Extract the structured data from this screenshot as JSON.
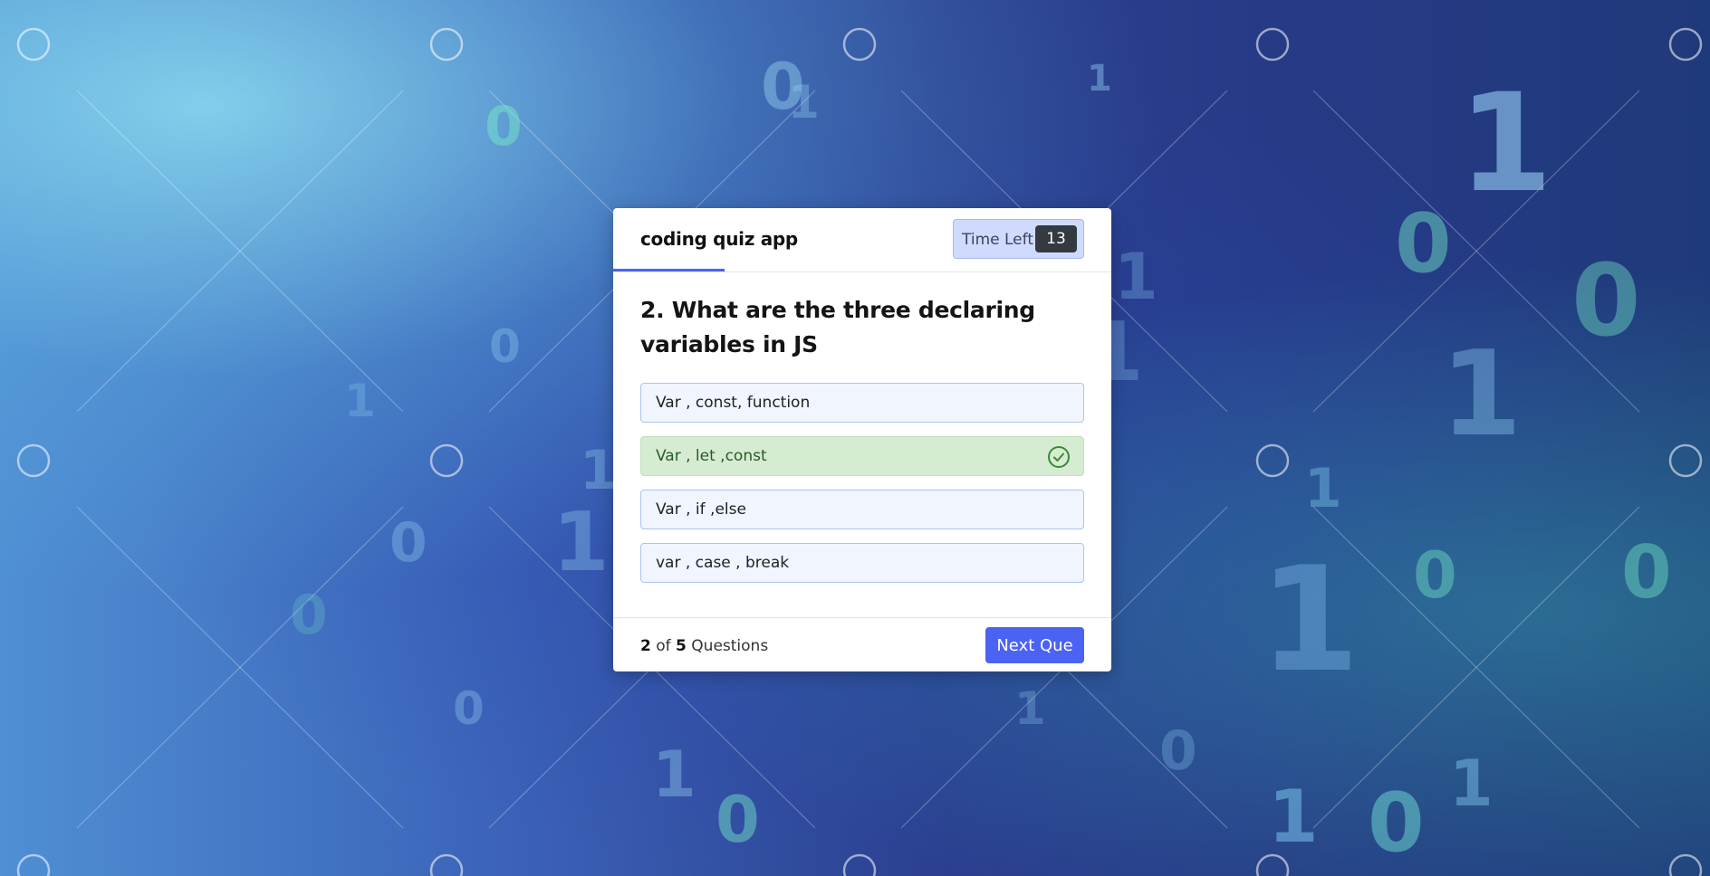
{
  "app": {
    "title": "coding quiz app"
  },
  "timer": {
    "label": "Time Left",
    "value": "13"
  },
  "question": {
    "number": "2",
    "text": "2. What are the three declaring variables in JS"
  },
  "options": [
    {
      "label": "Var , const, function",
      "state": "default"
    },
    {
      "label": "Var , let ,const",
      "state": "correct"
    },
    {
      "label": "Var , if ,else",
      "state": "default"
    },
    {
      "label": "var , case , break",
      "state": "default"
    }
  ],
  "footer": {
    "current": "2",
    "of": "of",
    "total": "5",
    "suffix": "Questions",
    "next_label": "Next Que"
  },
  "progress": {
    "fraction": 0.2
  },
  "colors": {
    "accent": "#4b63f2",
    "correct_bg": "#d5ecd2",
    "correct_icon": "#3a8a3a",
    "option_bg": "#f0f5ff",
    "option_border": "#a9c5ee",
    "timer_bg": "#cfdaff",
    "timer_value_bg": "#343a40"
  },
  "icons": {
    "correct": "check-circle-icon"
  }
}
